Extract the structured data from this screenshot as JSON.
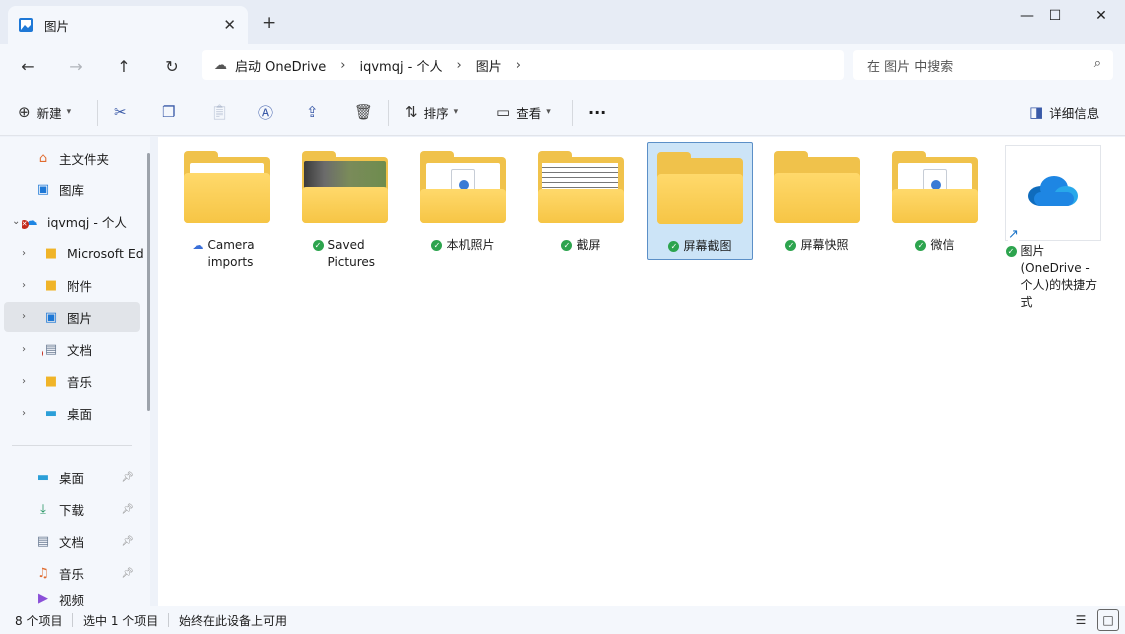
{
  "window": {
    "tab_title": "图片",
    "tab_icon": "pictures-folder-icon",
    "new_tab": "+",
    "minimize": "—",
    "maximize": "☐",
    "close": "✕"
  },
  "nav": {
    "back": "←",
    "forward": "→",
    "up": "↑",
    "refresh": "↻",
    "breadcrumbs": [
      "启动 OneDrive",
      "iqvmqj - 个人",
      "图片"
    ],
    "search_placeholder": "在 图片 中搜索"
  },
  "toolbar": {
    "new_label": "新建",
    "sort_label": "排序",
    "view_label": "查看",
    "more": "···",
    "details_label": "详细信息"
  },
  "sidebar": {
    "items": [
      {
        "label": "主文件夹",
        "icon": "home-icon"
      },
      {
        "label": "图库",
        "icon": "gallery-icon"
      },
      {
        "label": "iqvmqj - 个人",
        "icon": "onedrive-icon"
      },
      {
        "label": "Microsoft Ed",
        "icon": "folder-icon"
      },
      {
        "label": "附件",
        "icon": "folder-icon"
      },
      {
        "label": "图片",
        "icon": "pictures-icon"
      },
      {
        "label": "文档",
        "icon": "documents-icon"
      },
      {
        "label": "音乐",
        "icon": "folder-icon"
      },
      {
        "label": "桌面",
        "icon": "desktop-icon"
      }
    ],
    "quick_access": [
      {
        "label": "桌面",
        "icon": "desktop-icon"
      },
      {
        "label": "下载",
        "icon": "download-icon"
      },
      {
        "label": "文档",
        "icon": "documents-icon"
      },
      {
        "label": "音乐",
        "icon": "music-icon"
      },
      {
        "label": "视频",
        "icon": "video-icon"
      }
    ]
  },
  "files": [
    {
      "name": "Camera imports",
      "status": "cloud"
    },
    {
      "name": "Saved Pictures",
      "status": "ok"
    },
    {
      "name": "本机照片",
      "status": "ok"
    },
    {
      "name": "截屏",
      "status": "ok"
    },
    {
      "name": "屏幕截图",
      "status": "ok",
      "selected": true
    },
    {
      "name": "屏幕快照",
      "status": "ok"
    },
    {
      "name": "微信",
      "status": "ok"
    },
    {
      "name": "图片 (OneDrive - 个人)的快捷方式",
      "status": "ok"
    }
  ],
  "statusbar": {
    "item_count": "8 个项目",
    "selected": "选中 1 个项目",
    "availability": "始终在此设备上可用"
  },
  "colors": {
    "accent": "#1e86e3",
    "selection": "#cce4f7",
    "folder": "#f6c545",
    "sync_ok": "#2da44e"
  }
}
